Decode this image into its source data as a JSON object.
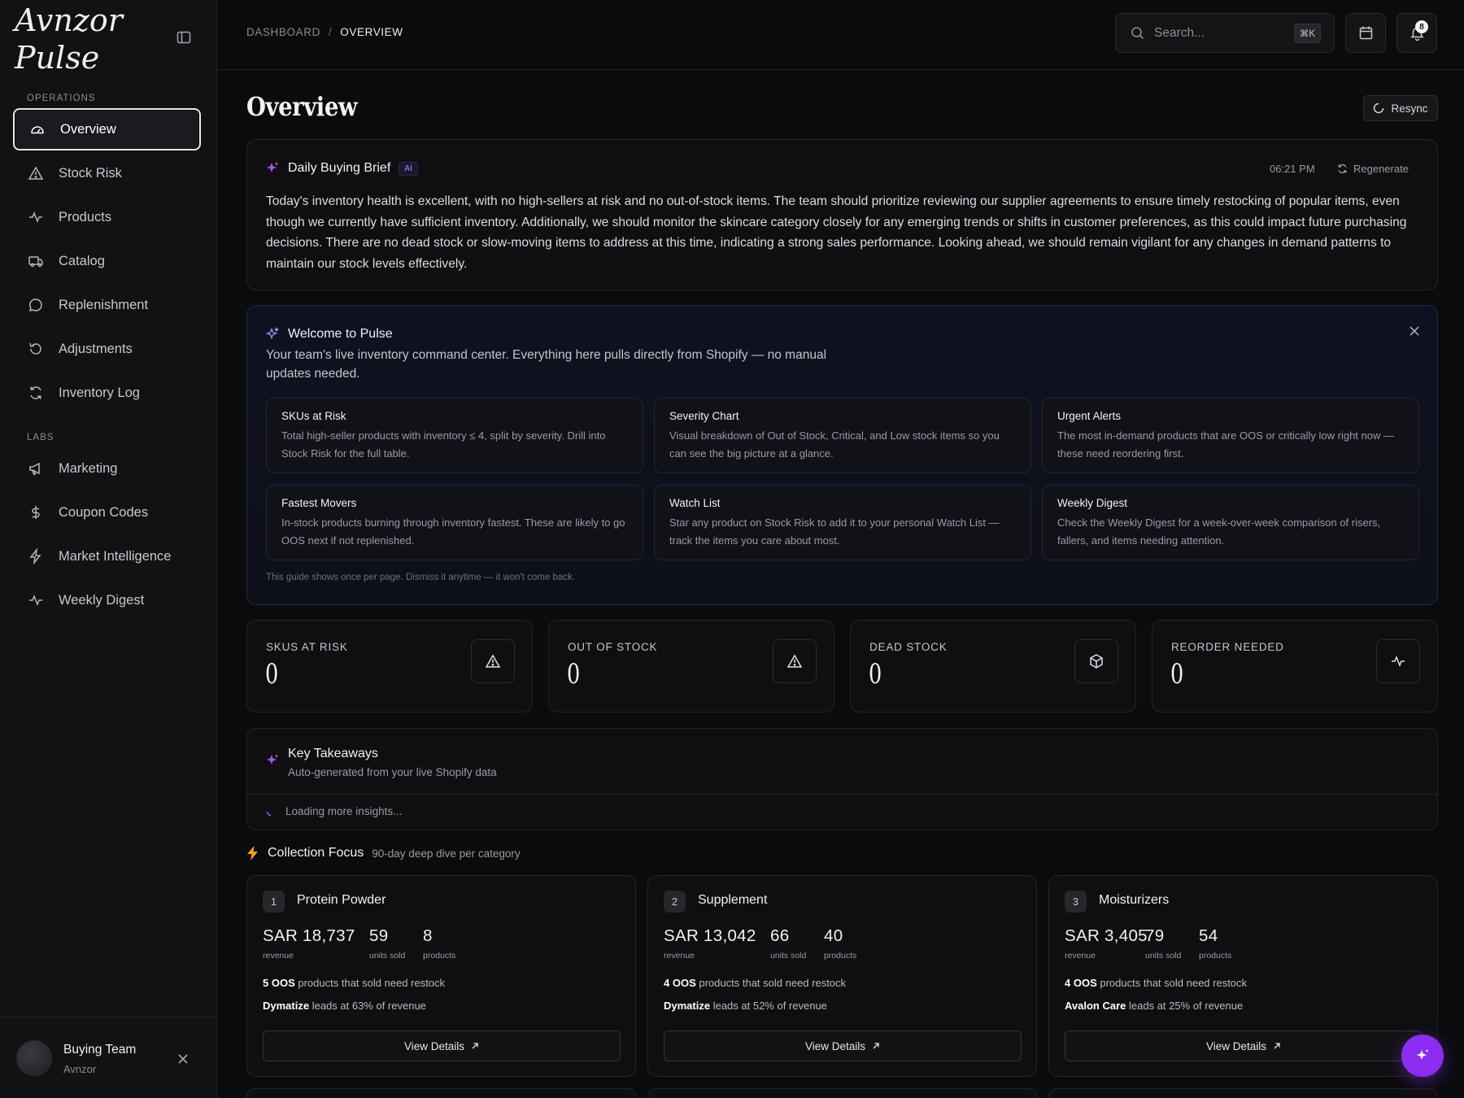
{
  "app": {
    "brand": "Avnzor Pulse"
  },
  "sidebar": {
    "sections": [
      {
        "label": "OPERATIONS"
      },
      {
        "label": "LABS"
      }
    ],
    "items": [
      {
        "label": "Overview",
        "icon": "gauge-icon",
        "active": true
      },
      {
        "label": "Stock Risk",
        "icon": "warning-icon"
      },
      {
        "label": "Products",
        "icon": "activity-icon"
      },
      {
        "label": "Catalog",
        "icon": "truck-icon"
      },
      {
        "label": "Replenishment",
        "icon": "chat-icon"
      },
      {
        "label": "Adjustments",
        "icon": "undo-icon"
      },
      {
        "label": "Inventory Log",
        "icon": "refresh-icon"
      },
      {
        "label": "Marketing",
        "icon": "megaphone-icon"
      },
      {
        "label": "Coupon Codes",
        "icon": "dollar-icon"
      },
      {
        "label": "Market Intelligence",
        "icon": "bolt-icon"
      },
      {
        "label": "Weekly Digest",
        "icon": "activity-icon"
      }
    ],
    "footer": {
      "team": "Buying Team",
      "org": "Avnzor"
    }
  },
  "topbar": {
    "breadcrumb": [
      "DASHBOARD",
      "/",
      "OVERVIEW"
    ],
    "search": {
      "placeholder": "Search...",
      "shortcut": "⌘K"
    },
    "notifications_count": "8"
  },
  "page": {
    "title": "Overview",
    "resync_label": "Resync"
  },
  "brief": {
    "title": "Daily Buying Brief",
    "tag": "AI",
    "time": "06:21 PM",
    "regenerate_label": "Regenerate",
    "text": "Today's inventory health is excellent, with no high-sellers at risk and no out-of-stock items. The team should prioritize reviewing our supplier agreements to ensure timely restocking of popular items, even though we currently have sufficient inventory. Additionally, we should monitor the skincare category closely for any emerging trends or shifts in customer preferences, as this could impact future purchasing decisions. There are no dead stock or slow-moving items to address at this time, indicating a strong sales performance. Looking ahead, we should remain vigilant for any changes in demand patterns to maintain our stock levels effectively."
  },
  "welcome": {
    "title": "Welcome to Pulse",
    "subtitle": "Your team's live inventory command center. Everything here pulls directly from Shopify — no manual updates needed.",
    "tips": [
      {
        "title": "SKUs at Risk",
        "desc": "Total high-seller products with inventory ≤ 4, split by severity. Drill into Stock Risk for the full table."
      },
      {
        "title": "Severity Chart",
        "desc": "Visual breakdown of Out of Stock, Critical, and Low stock items so you can see the big picture at a glance."
      },
      {
        "title": "Urgent Alerts",
        "desc": "The most in-demand products that are OOS or critically low right now — these need reordering first."
      },
      {
        "title": "Fastest Movers",
        "desc": "In-stock products burning through inventory fastest. These are likely to go OOS next if not replenished."
      },
      {
        "title": "Watch List",
        "desc": "Star any product on Stock Risk to add it to your personal Watch List — track the items you care about most."
      },
      {
        "title": "Weekly Digest",
        "desc": "Check the Weekly Digest for a week-over-week comparison of risers, fallers, and items needing attention."
      }
    ],
    "footnote": "This guide shows once per page. Dismiss it anytime — it won't come back."
  },
  "kpis": [
    {
      "label": "SKUS AT RISK",
      "value": "0",
      "icon": "warning-icon"
    },
    {
      "label": "OUT OF STOCK",
      "value": "0",
      "icon": "warning-icon"
    },
    {
      "label": "DEAD STOCK",
      "value": "0",
      "icon": "box-icon"
    },
    {
      "label": "REORDER NEEDED",
      "value": "0",
      "icon": "activity-icon"
    }
  ],
  "takeaways": {
    "title": "Key Takeaways",
    "subtitle": "Auto-generated from your live Shopify data",
    "loading": "Loading more insights..."
  },
  "collection_focus": {
    "title": "Collection Focus",
    "subtitle": "90-day deep dive per category",
    "cards": [
      {
        "rank": "1",
        "name": "Protein Powder",
        "revenue": "SAR 18,737",
        "revenue_label": "revenue",
        "units": "59",
        "units_label": "units sold",
        "products": "8",
        "products_label": "products",
        "oos_count": "5 OOS",
        "oos_text": "products that sold need restock",
        "leader": "Dymatize",
        "leader_text": "leads at 63% of revenue",
        "button": "View Details"
      },
      {
        "rank": "2",
        "name": "Supplement",
        "revenue": "SAR 13,042",
        "revenue_label": "revenue",
        "units": "66",
        "units_label": "units sold",
        "products": "40",
        "products_label": "products",
        "oos_count": "4 OOS",
        "oos_text": "products that sold need restock",
        "leader": "Dymatize",
        "leader_text": "leads at 52% of revenue",
        "button": "View Details"
      },
      {
        "rank": "3",
        "name": "Moisturizers",
        "revenue": "SAR 3,405",
        "revenue_label": "revenue",
        "units": "79",
        "units_label": "units sold",
        "products": "54",
        "products_label": "products",
        "oos_count": "4 OOS",
        "oos_text": "products that sold need restock",
        "leader": "Avalon Care",
        "leader_text": "leads at 25% of revenue",
        "button": "View Details"
      }
    ]
  },
  "colors": {
    "accent": "#8b2cf0",
    "ai_purple": "#a78bfa",
    "lightning": "#f5a623"
  }
}
